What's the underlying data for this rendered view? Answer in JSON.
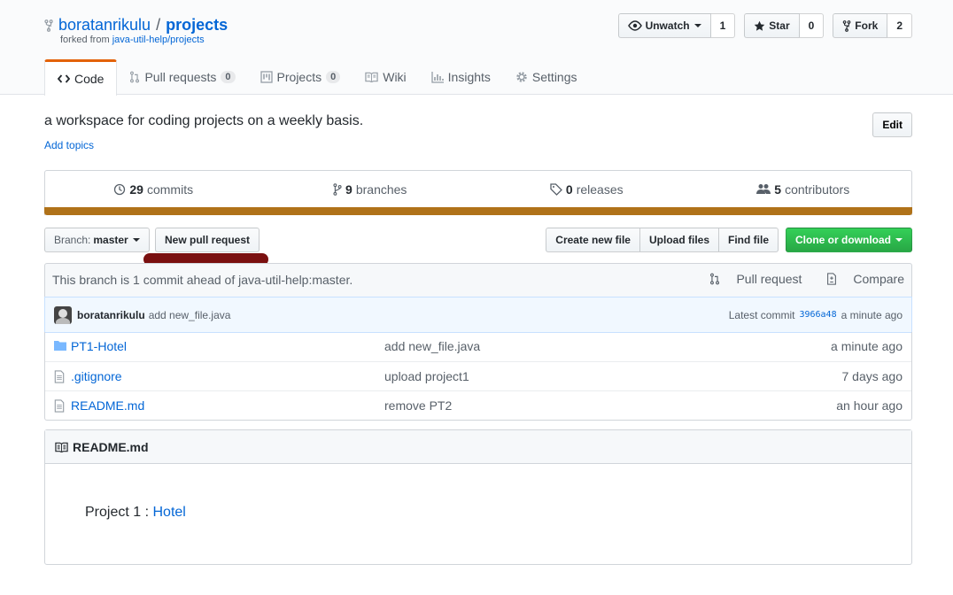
{
  "repo": {
    "owner": "boratanrikulu",
    "separator": "/",
    "name": "projects",
    "forked_prefix": "forked from",
    "forked_from": "java-util-help/projects"
  },
  "actions": {
    "watch_label": "Unwatch",
    "watch_count": "1",
    "star_label": "Star",
    "star_count": "0",
    "fork_label": "Fork",
    "fork_count": "2"
  },
  "tabs": [
    {
      "label": "Code",
      "icon": "code-icon"
    },
    {
      "label": "Pull requests",
      "counter": "0",
      "icon": "pull-request-icon"
    },
    {
      "label": "Projects",
      "counter": "0",
      "icon": "project-icon"
    },
    {
      "label": "Wiki",
      "icon": "book-icon"
    },
    {
      "label": "Insights",
      "icon": "graph-icon"
    },
    {
      "label": "Settings",
      "icon": "gear-icon"
    }
  ],
  "description": "a workspace for coding projects on a weekly basis.",
  "add_topics": "Add topics",
  "edit_label": "Edit",
  "numbers": {
    "commits_count": "29",
    "commits_label": "commits",
    "branches_count": "9",
    "branches_label": "branches",
    "releases_count": "0",
    "releases_label": "releases",
    "contributors_count": "5",
    "contributors_label": "contributors",
    "language_color": "#b07219"
  },
  "filenav": {
    "branch_prefix": "Branch:",
    "branch_name": "master",
    "new_pr": "New pull request",
    "create_file": "Create new file",
    "upload_files": "Upload files",
    "find_file": "Find file",
    "clone": "Clone or download"
  },
  "compare": {
    "message": "This branch is 1 commit ahead of java-util-help:master.",
    "pull_request": "Pull request",
    "compare": "Compare"
  },
  "latest_commit": {
    "author": "boratanrikulu",
    "message": "add new_file.java",
    "prefix": "Latest commit",
    "sha": "3966a48",
    "age": "a minute ago"
  },
  "files": [
    {
      "name": "PT1-Hotel",
      "type": "dir",
      "message": "add new_file.java",
      "age": "a minute ago"
    },
    {
      "name": ".gitignore",
      "type": "file",
      "message": "upload project1",
      "age": "7 days ago"
    },
    {
      "name": "README.md",
      "type": "file",
      "message": "remove PT2",
      "age": "an hour ago"
    }
  ],
  "readme": {
    "title": "README.md",
    "line_prefix": "Project 1 : ",
    "link": "Hotel"
  }
}
